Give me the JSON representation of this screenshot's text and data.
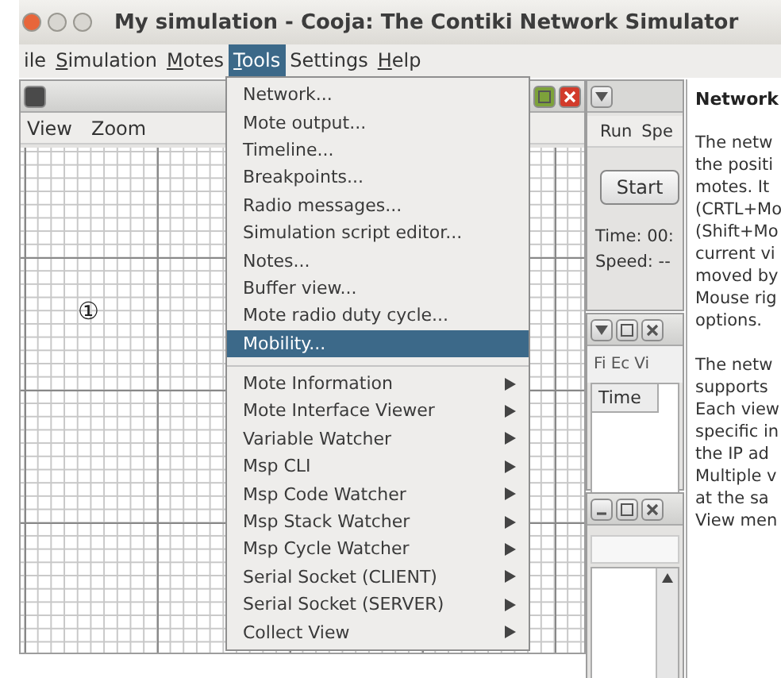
{
  "window": {
    "title": "My simulation - Cooja: The Contiki Network Simulator"
  },
  "menubar": [
    {
      "label": "ile",
      "mnemonic": false,
      "selected": false
    },
    {
      "label": "Simulation",
      "mnemonic": true,
      "selected": false
    },
    {
      "label": "Motes",
      "mnemonic": true,
      "selected": false
    },
    {
      "label": "Tools",
      "mnemonic": true,
      "selected": true
    },
    {
      "label": "Settings",
      "mnemonic": false,
      "selected": false
    },
    {
      "label": "Help",
      "mnemonic": true,
      "selected": false
    }
  ],
  "network_window": {
    "menu": [
      "View",
      "Zoom"
    ],
    "motes": [
      {
        "label": "①"
      }
    ]
  },
  "tools_menu": [
    {
      "kind": "item",
      "label": "Network...",
      "selected": false
    },
    {
      "kind": "item",
      "label": "Mote output...",
      "selected": false
    },
    {
      "kind": "item",
      "label": "Timeline...",
      "selected": false
    },
    {
      "kind": "item",
      "label": "Breakpoints...",
      "selected": false
    },
    {
      "kind": "item",
      "label": "Radio messages...",
      "selected": false
    },
    {
      "kind": "item",
      "label": "Simulation script editor...",
      "selected": false
    },
    {
      "kind": "item",
      "label": "Notes...",
      "selected": false
    },
    {
      "kind": "item",
      "label": "Buffer view...",
      "selected": false
    },
    {
      "kind": "item",
      "label": "Mote radio duty cycle...",
      "selected": false
    },
    {
      "kind": "item",
      "label": "Mobility...",
      "selected": true
    },
    {
      "kind": "separator"
    },
    {
      "kind": "submenu",
      "label": "Mote Information",
      "selected": false
    },
    {
      "kind": "submenu",
      "label": "Mote Interface Viewer",
      "selected": false
    },
    {
      "kind": "submenu",
      "label": "Variable Watcher",
      "selected": false
    },
    {
      "kind": "submenu",
      "label": "Msp CLI",
      "selected": false
    },
    {
      "kind": "submenu",
      "label": "Msp Code Watcher",
      "selected": false
    },
    {
      "kind": "submenu",
      "label": "Msp Stack Watcher",
      "selected": false
    },
    {
      "kind": "submenu",
      "label": "Msp Cycle Watcher",
      "selected": false
    },
    {
      "kind": "submenu",
      "label": "Serial Socket (CLIENT)",
      "selected": false
    },
    {
      "kind": "submenu",
      "label": "Serial Socket (SERVER)",
      "selected": false
    },
    {
      "kind": "submenu",
      "label": "Collect View",
      "selected": false
    }
  ],
  "sim_control": {
    "menu": [
      "Run",
      "Spe"
    ],
    "start_button": "Start",
    "time": "Time: 00:",
    "speed": "Speed: --"
  },
  "log_window": {
    "tabs": [
      "Fi",
      "Ec",
      "Vi"
    ],
    "column": "Time"
  },
  "notes": {
    "title": "Network",
    "paragraphs": [
      [
        "The netw",
        "the positi",
        "motes. It",
        "(CRTL+Mo",
        "(Shift+Mo",
        "current vi",
        "moved by",
        "Mouse rig",
        "options."
      ],
      [
        "The netw",
        "supports",
        "Each view",
        "specific in",
        "the IP ad",
        "Multiple v",
        "at the sa",
        "View men"
      ]
    ]
  }
}
